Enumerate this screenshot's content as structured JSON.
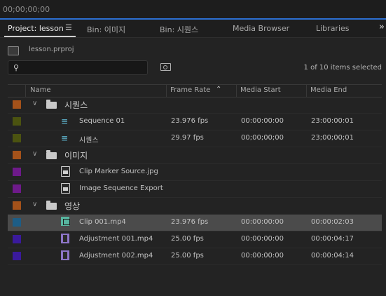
{
  "timecode": "00;00;00;00",
  "tabs": [
    {
      "label": "Project: lesson",
      "active": true
    },
    {
      "label": "Bin: 이미지",
      "active": false
    },
    {
      "label": "Bin: 시퀀스",
      "active": false
    },
    {
      "label": "Media Browser",
      "active": false
    },
    {
      "label": "Libraries",
      "active": false
    }
  ],
  "tab_menu_icon": "hamburger-icon",
  "overflow_icon": "chevron-double-right-icon",
  "project_file": "lesson.prproj",
  "search": {
    "placeholder": "",
    "icon": "search-icon"
  },
  "selected_count": "1 of 10 items selected",
  "columns": {
    "name": "Name",
    "fps": "Frame Rate",
    "start": "Media Start",
    "end": "Media End"
  },
  "rows": [
    {
      "kind": "folder",
      "label_color": "#a4521a",
      "name": "시퀀스",
      "fps": "",
      "start": "",
      "end": ""
    },
    {
      "kind": "sequence",
      "label_color": "#4b5310",
      "name": "Sequence 01",
      "fps": "23.976 fps",
      "start": "00:00:00:00",
      "end": "23:00:00:01"
    },
    {
      "kind": "sequence",
      "label_color": "#4b5310",
      "name": "시퀀스",
      "fps": "29.97 fps",
      "start": "00;00;00;00",
      "end": "23;00;00;01"
    },
    {
      "kind": "folder",
      "label_color": "#a4521a",
      "name": "이미지",
      "fps": "",
      "start": "",
      "end": ""
    },
    {
      "kind": "still",
      "label_color": "#6e1a8a",
      "name": "Clip Marker Source.jpg",
      "fps": "",
      "start": "",
      "end": ""
    },
    {
      "kind": "still",
      "label_color": "#6e1a8a",
      "name": "Image Sequence Export",
      "fps": "",
      "start": "",
      "end": ""
    },
    {
      "kind": "folder",
      "label_color": "#a4521a",
      "name": "영상",
      "fps": "",
      "start": "",
      "end": ""
    },
    {
      "kind": "clip",
      "label_color": "#1d5d86",
      "name": "Clip 001.mp4",
      "fps": "23.976 fps",
      "start": "00:00:00:00",
      "end": "00:00:02:03",
      "selected": true
    },
    {
      "kind": "adjustment",
      "label_color": "#3a1a9c",
      "name": "Adjustment 001.mp4",
      "fps": "25.00 fps",
      "start": "00:00:00:00",
      "end": "00:00:04:17"
    },
    {
      "kind": "adjustment",
      "label_color": "#3a1a9c",
      "name": "Adjustment 002.mp4",
      "fps": "25.00 fps",
      "start": "00:00:00:00",
      "end": "00:00:04:14"
    }
  ]
}
